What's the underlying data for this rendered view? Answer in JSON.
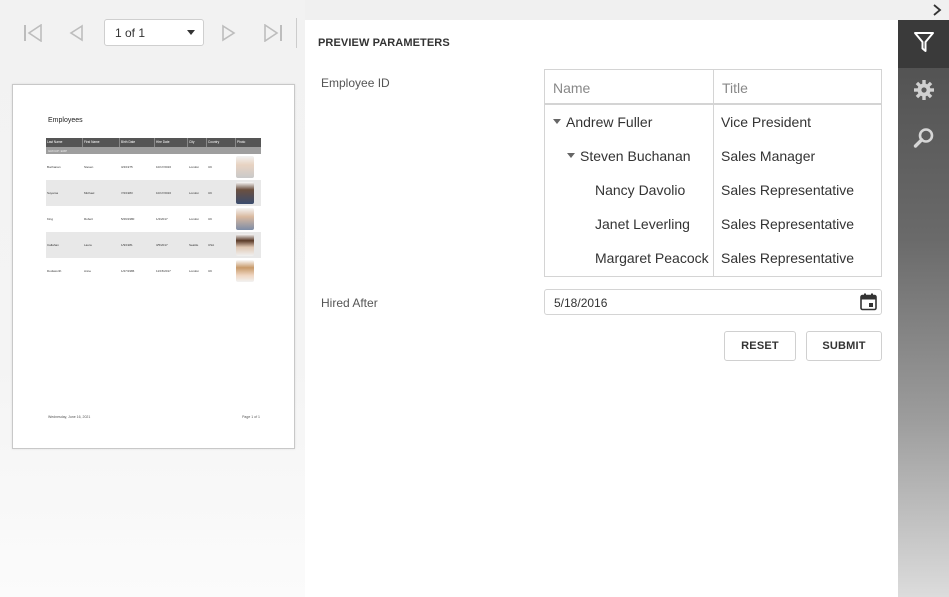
{
  "toolbar": {
    "page_indicator": "1 of 1",
    "icons": [
      "first-page-icon",
      "previous-page-icon",
      "next-page-icon",
      "last-page-icon"
    ]
  },
  "report": {
    "title": "Employees",
    "columns": [
      "Last Name",
      "First Name",
      "Birth Date",
      "Hire Date",
      "City",
      "Country",
      "Photo"
    ],
    "group_label": "GROUP: EMP",
    "rows": [
      {
        "last": "Buchanan",
        "first": "Steven",
        "birth": "3/4/1975",
        "hire": "10/17/2016",
        "city": "London",
        "country": "UK"
      },
      {
        "last": "Suyama",
        "first": "Michael",
        "birth": "7/2/1983",
        "hire": "10/17/2016",
        "city": "London",
        "country": "UK"
      },
      {
        "last": "King",
        "first": "Robert",
        "birth": "5/29/1980",
        "hire": "1/2/2017",
        "city": "London",
        "country": "UK"
      },
      {
        "last": "Callahan",
        "first": "Laura",
        "birth": "1/9/1981",
        "hire": "3/5/2017",
        "city": "Seattle",
        "country": "USA"
      },
      {
        "last": "Dodsworth",
        "first": "Anne",
        "birth": "1/27/1986",
        "hire": "11/15/2017",
        "city": "London",
        "country": "UK"
      }
    ],
    "footer_left": "Wednesday, June 16, 2021",
    "footer_right": "Page 1 of 1"
  },
  "params": {
    "title": "PREVIEW PARAMETERS",
    "employee_label": "Employee ID",
    "hired_label": "Hired After",
    "hired_value": "5/18/2016",
    "grid": {
      "col_name": "Name",
      "col_title": "Title",
      "rows": [
        {
          "name": "Andrew Fuller",
          "title": "Vice President"
        },
        {
          "name": "Steven Buchanan",
          "title": "Sales Manager"
        },
        {
          "name": "Nancy Davolio",
          "title": "Sales Representative"
        },
        {
          "name": "Janet Leverling",
          "title": "Sales Representative"
        },
        {
          "name": "Margaret Peacock",
          "title": "Sales Representative"
        }
      ]
    },
    "reset_label": "RESET",
    "submit_label": "SUBMIT"
  },
  "tabs": [
    "filter-icon",
    "gear-icon",
    "search-icon"
  ],
  "colors": {
    "accent_dark": "#3a3a3a",
    "panel_bg": "#ffffff",
    "viewer_bg": "#f2f2f2"
  }
}
